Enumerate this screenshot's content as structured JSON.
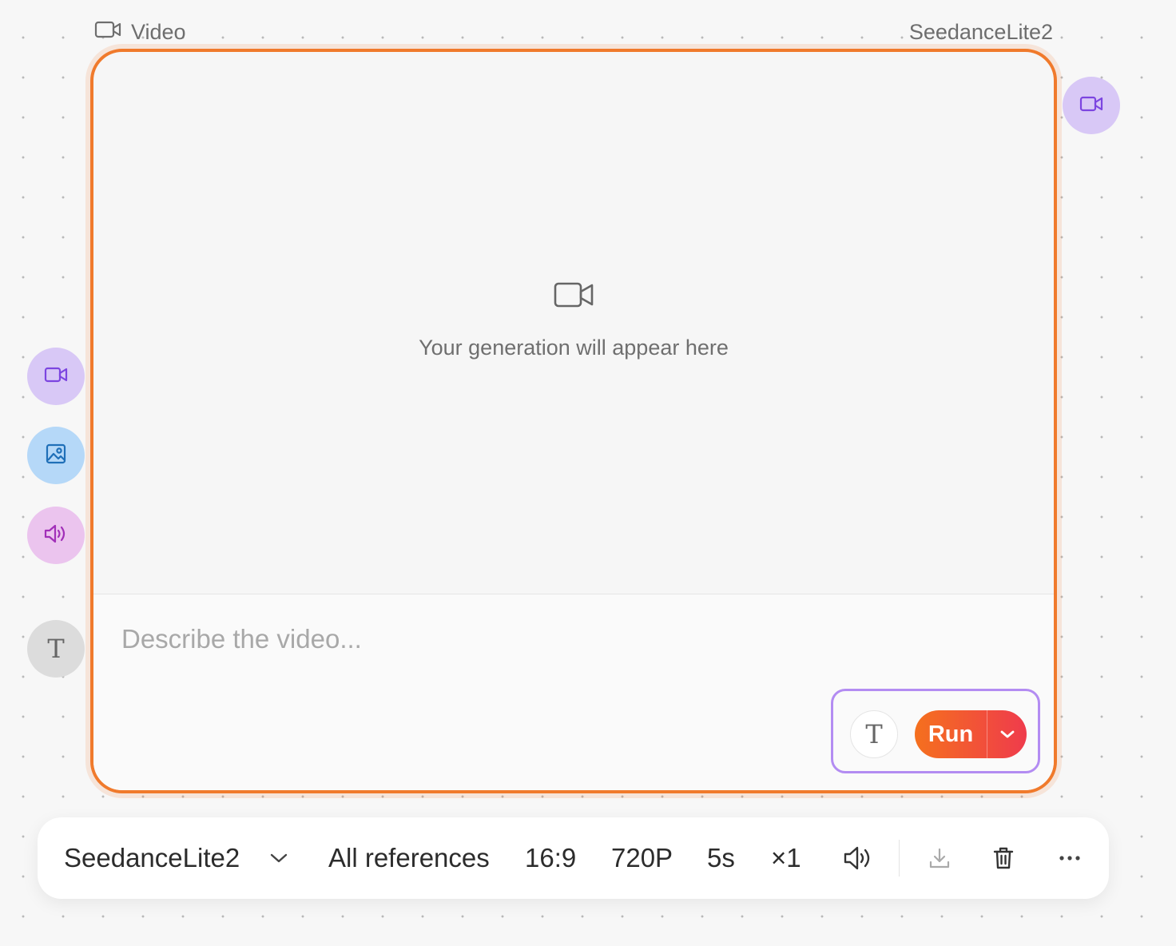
{
  "node": {
    "type_label": "Video",
    "model_label": "SeedanceLite2",
    "empty_message": "Your generation will appear here",
    "prompt_placeholder": "Describe the video...",
    "prompt_value": ""
  },
  "actions": {
    "text_button_glyph": "T",
    "run_label": "Run"
  },
  "side_inputs": {
    "text_glyph": "T"
  },
  "toolbar": {
    "model": "SeedanceLite2",
    "references": "All references",
    "aspect_ratio": "16:9",
    "resolution": "720P",
    "duration": "5s",
    "count": "×1"
  },
  "colors": {
    "accent_orange": "#f07a2c",
    "run_gradient_start": "#f5701e",
    "run_gradient_end": "#ef3b4c",
    "video_purple": "#7c45e0",
    "image_blue": "#1f6fb8",
    "audio_magenta": "#a12fb8",
    "action_border": "#b38cf2"
  },
  "icons": {
    "header": "video-camera-icon",
    "output_port": "video-camera-icon",
    "inputs": [
      "video-camera-icon",
      "image-icon",
      "speaker-icon",
      "text-icon"
    ],
    "toolbar": [
      "chevron-down-icon",
      "speaker-icon",
      "download-icon",
      "trash-icon",
      "more-icon"
    ]
  }
}
